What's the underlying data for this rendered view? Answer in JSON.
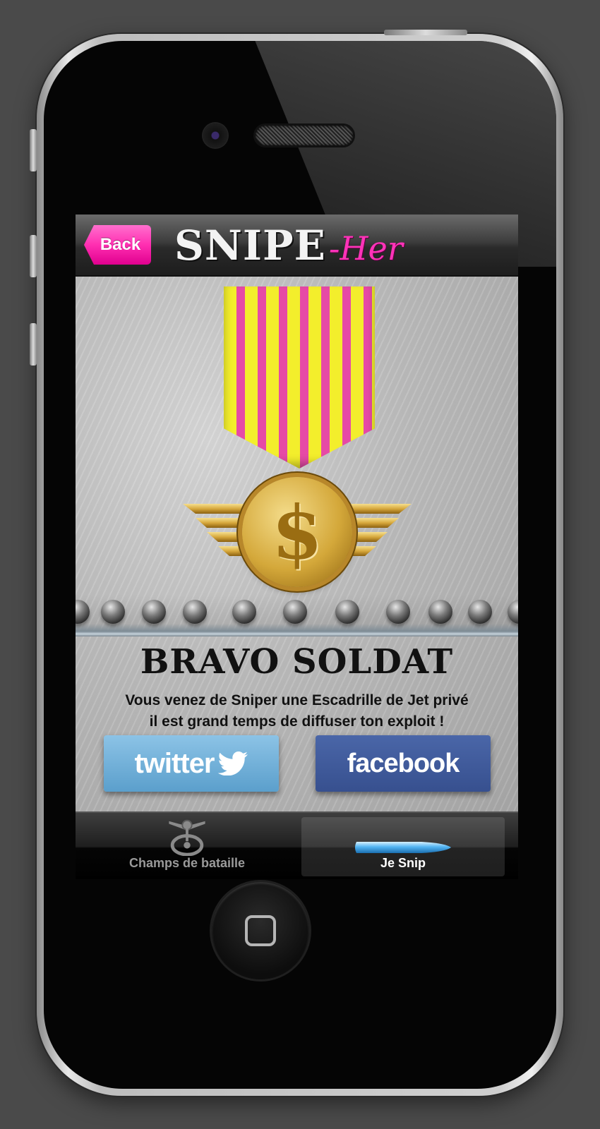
{
  "device": {
    "model": "iphone"
  },
  "nav": {
    "back_label": "Back",
    "logo_main": "SNIPE",
    "logo_accent": "-Her",
    "back_color": "#ff2fb1"
  },
  "medal": {
    "symbol": "$",
    "ribbon_colors": [
      "#f3ee2c",
      "#e64aa6"
    ]
  },
  "main": {
    "headline": "BRAVO SOLDAT",
    "message_line1": "Vous venez de Sniper une Escadrille de Jet privé",
    "message_line2": "il est grand temps de diffuser ton exploit !"
  },
  "share": {
    "twitter_label": "twitter",
    "twitter_icon": "bird-icon",
    "twitter_color": "#5b9fcc",
    "facebook_label": "facebook",
    "facebook_color": "#3b5998"
  },
  "tabbar": {
    "tabs": [
      {
        "label": "Champs de bataille",
        "icon": "crosshair-turret-icon",
        "selected": false
      },
      {
        "label": "Je Snip",
        "icon": "bullet-icon",
        "selected": true
      }
    ]
  }
}
